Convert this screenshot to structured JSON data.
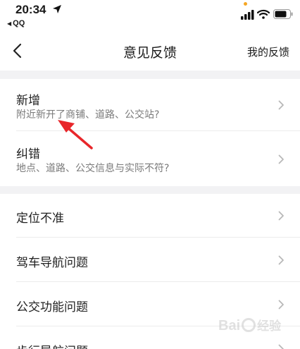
{
  "status_bar": {
    "time": "20:34",
    "back_app": "QQ",
    "back_icon": "back-triangle-icon",
    "location_icon": "location-arrow-icon",
    "signal_icon": "cellular-signal-icon",
    "wifi_icon": "wifi-icon",
    "battery_icon": "battery-icon",
    "indicator_color": "#f5a623"
  },
  "nav": {
    "title": "意见反馈",
    "right_link": "我的反馈",
    "back_icon": "chevron-left-icon"
  },
  "sections": [
    {
      "items": [
        {
          "title": "新增",
          "subtitle": "附近新开了商铺、道路、公交站?"
        },
        {
          "title": "纠错",
          "subtitle": "地点、道路、公交信息与实际不符?"
        }
      ]
    },
    {
      "items": [
        {
          "title": "定位不准"
        },
        {
          "title": "驾车导航问题"
        },
        {
          "title": "公交功能问题"
        },
        {
          "title": "步行导航问题"
        }
      ]
    }
  ],
  "annotation": {
    "arrow_color": "#e8262a"
  },
  "watermark": {
    "text": "Bai",
    "suffix": "经验"
  },
  "colors": {
    "section_gap": "#f2f2f4",
    "subtitle": "#7a7a7a",
    "chevron": "#b8b8b8"
  }
}
